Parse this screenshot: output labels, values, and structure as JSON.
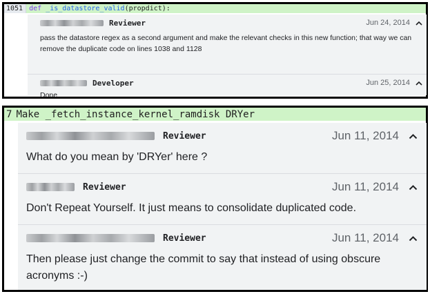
{
  "panel1": {
    "code_line": {
      "line_number": "1051",
      "keyword": "def",
      "function_name": "_is_datastore_valid",
      "args": "(propdict):"
    },
    "comments": [
      {
        "role": "Reviewer",
        "date": "Jun 24, 2014",
        "chevron": "chevron-up-icon",
        "text": "pass the datastore regex as a second argument and make the relevant checks in this new function; that way we can remove the duplicate code on lines 1038 and 1128"
      },
      {
        "role": "Developer",
        "date": "Jun 25, 2014",
        "chevron": "chevron-up-icon",
        "text": "Done"
      }
    ]
  },
  "panel2": {
    "code_line": {
      "line_number": "7",
      "text": "Make _fetch_instance_kernel_ramdisk DRYer"
    },
    "comments": [
      {
        "role": "Reviewer",
        "date": "Jun 11, 2014",
        "chevron": "chevron-up-icon",
        "text": "What do you mean by 'DRYer' here ?"
      },
      {
        "role": "Reviewer",
        "date": "Jun 11, 2014",
        "chevron": "chevron-up-icon",
        "text": "Don't Repeat Yourself. It just means to consolidate duplicated code."
      },
      {
        "role": "Reviewer",
        "date": "Jun 11, 2014",
        "chevron": "chevron-up-icon",
        "text": "Then please just change the commit to say that instead of using obscure acronyms :-)"
      }
    ]
  },
  "colors": {
    "code_highlight": "#cff3c7",
    "thread_background": "#f1f3f4",
    "panel_border": "#000000"
  }
}
